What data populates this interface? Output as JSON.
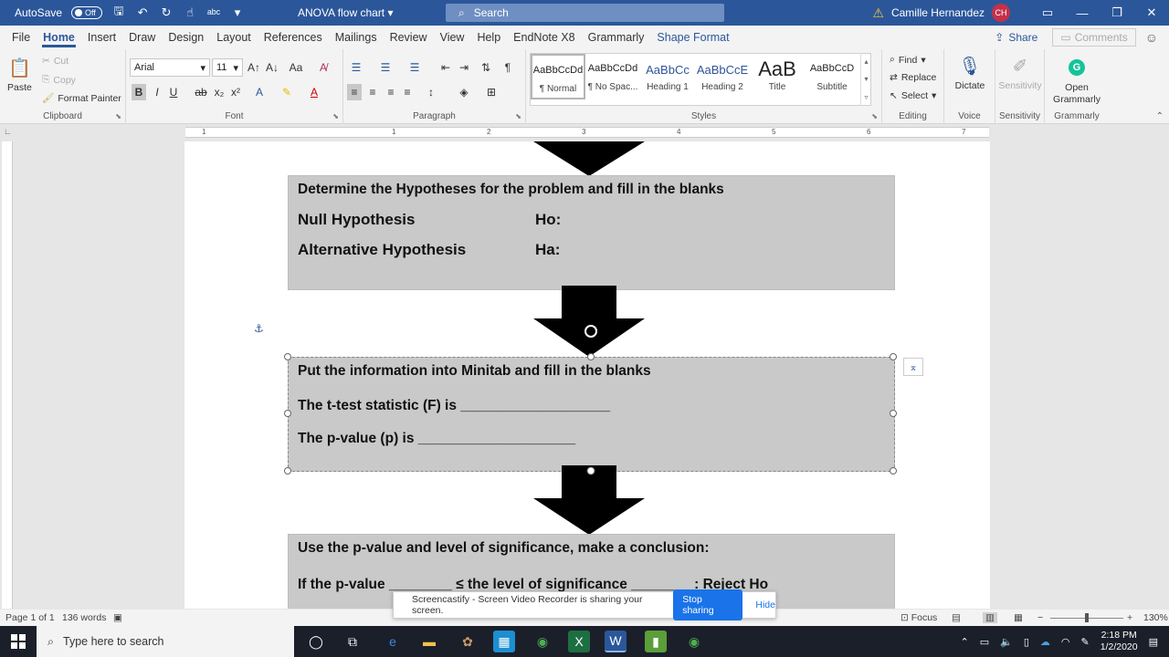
{
  "titlebar": {
    "autosave_label": "AutoSave",
    "autosave_state": "Off",
    "doc_title": "ANOVA flow chart",
    "search_placeholder": "Search",
    "user_name": "Camille Hernandez",
    "user_initials": "CH"
  },
  "tabs": [
    "File",
    "Home",
    "Insert",
    "Draw",
    "Design",
    "Layout",
    "References",
    "Mailings",
    "Review",
    "View",
    "Help",
    "EndNote X8",
    "Grammarly",
    "Shape Format"
  ],
  "tabs_right": {
    "share": "Share",
    "comments": "Comments"
  },
  "ribbon": {
    "clipboard": {
      "label": "Clipboard",
      "paste": "Paste",
      "cut": "Cut",
      "copy": "Copy",
      "format_painter": "Format Painter"
    },
    "font": {
      "label": "Font",
      "font_name": "Arial",
      "font_size": "11"
    },
    "paragraph": {
      "label": "Paragraph"
    },
    "styles": {
      "label": "Styles",
      "items": [
        {
          "preview": "AaBbCcDd",
          "name": "¶ Normal"
        },
        {
          "preview": "AaBbCcDd",
          "name": "¶ No Spac..."
        },
        {
          "preview": "AaBbCc",
          "name": "Heading 1"
        },
        {
          "preview": "AaBbCcE",
          "name": "Heading 2"
        },
        {
          "preview": "AaB",
          "name": "Title"
        },
        {
          "preview": "AaBbCcD",
          "name": "Subtitle"
        }
      ]
    },
    "editing": {
      "label": "Editing",
      "find": "Find",
      "replace": "Replace",
      "select": "Select"
    },
    "voice": {
      "label": "Voice",
      "dictate": "Dictate"
    },
    "sensitivity": {
      "label": "Sensitivity",
      "button": "Sensitivity"
    },
    "grammarly": {
      "label": "Grammarly",
      "open": "Open Grammarly"
    }
  },
  "ruler_numbers": [
    "1",
    "1",
    "2",
    "3",
    "4",
    "5",
    "6",
    "7"
  ],
  "document": {
    "box1": {
      "line1": "Determine the Hypotheses for the problem and fill in the blanks",
      "null_label": "Null Hypothesis",
      "null_symbol": "Ho:",
      "alt_label": "Alternative Hypothesis",
      "alt_symbol": "Ha:"
    },
    "box2": {
      "line1": "Put the information into Minitab and fill in the blanks",
      "line2": "The t-test statistic (F) is ___________________",
      "line3": "The p-value (p) is ____________________"
    },
    "box3": {
      "line1": "Use the p-value and level of significance, make a conclusion:",
      "line2": "If the p-value ________ ≤ the level of significance ________: Reject Ho"
    }
  },
  "statusbar": {
    "page": "Page 1 of 1",
    "words": "136 words",
    "focus": "Focus",
    "zoom": "130%"
  },
  "screencast": {
    "message": "Screencastify - Screen Video Recorder is sharing your screen.",
    "stop": "Stop sharing",
    "hide": "Hide"
  },
  "taskbar": {
    "search_placeholder": "Type here to search",
    "time": "2:18 PM",
    "date": "1/2/2020"
  }
}
